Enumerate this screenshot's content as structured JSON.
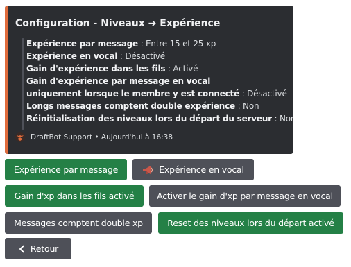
{
  "embed": {
    "title": "Configuration - Niveaux ➔ Expérience",
    "lines": [
      {
        "label": "Expérience par message",
        "value": " : Entre 15 et 25 xp"
      },
      {
        "label": "Expérience en vocal",
        "value": " : Désactivé"
      },
      {
        "label": "Gain d'expérience dans les fils",
        "value": " : Activé"
      },
      {
        "label": "Gain d'expérience par message en vocal",
        "value": ""
      },
      {
        "label": "uniquement lorsque le membre y est connecté",
        "value": " : Désactivé"
      },
      {
        "label": "Longs messages comptent double expérience",
        "value": " : Non"
      },
      {
        "label": "Réinitialisation des niveaux lors du départ du serveur",
        "value": " : Non"
      }
    ],
    "footer": "DraftBot Support • Aujourd'hui à 16:38",
    "accent_color": "#e06c3c"
  },
  "buttons": {
    "xp_message": "Expérience par message",
    "xp_vocal": "Expérience en vocal",
    "xp_threads": "Gain d'xp dans les fils activé",
    "xp_message_vocal": "Activer le gain d'xp par message en vocal",
    "double_xp": "Messages comptent double xp",
    "reset_levels": "Reset des niveaux lors du départ activé",
    "back": "Retour"
  },
  "colors": {
    "green": "#248046",
    "gray": "#4e5058",
    "embed_bg": "#2b2d31"
  },
  "icons": {
    "footer": "draftbot-avatar-icon",
    "vocal_button": "megaphone-icon",
    "back_button": "chevron-left-icon"
  }
}
